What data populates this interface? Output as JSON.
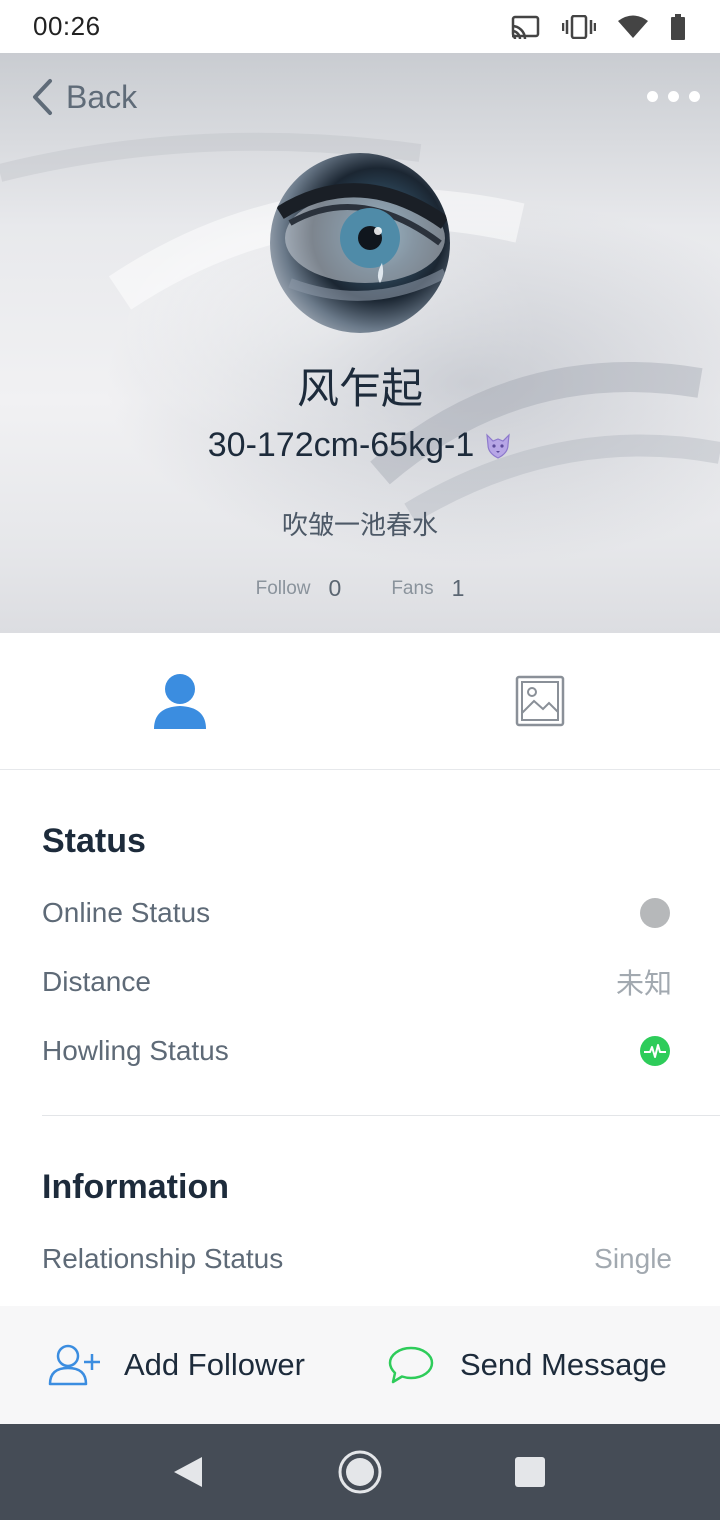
{
  "status_bar": {
    "time": "00:26",
    "icons": [
      "cast-icon",
      "vibrate-icon",
      "wifi-icon",
      "battery-icon"
    ]
  },
  "header": {
    "back_label": "Back",
    "more_icon": "more-dots-icon",
    "username": "风乍起",
    "stats": "30-172cm-65kg-1",
    "signature": "吹皱一池春水",
    "follow_label": "Follow",
    "follow_count": "0",
    "fans_label": "Fans",
    "fans_count": "1"
  },
  "tabs": [
    {
      "icon": "person-icon",
      "active": true,
      "color": "#3b8de0"
    },
    {
      "icon": "image-icon",
      "active": false,
      "color": "#8a9098"
    }
  ],
  "status_section": {
    "title": "Status",
    "rows": [
      {
        "label": "Online Status",
        "value_icon": "gray-dot-icon",
        "color": "#b6b8ba"
      },
      {
        "label": "Distance",
        "value": "未知"
      },
      {
        "label": "Howling Status",
        "value_icon": "pulse-icon",
        "color": "#2ecc5a"
      }
    ]
  },
  "information_section": {
    "title": "Information",
    "rows": [
      {
        "label": "Relationship Status",
        "value": "Single"
      }
    ]
  },
  "actions": {
    "add_follower": "Add Follower",
    "send_message": "Send Message",
    "add_icon_color": "#3b8de0",
    "message_icon_color": "#2ecc5a"
  },
  "nav_bar": {
    "buttons": [
      "back-triangle-icon",
      "home-circle-icon",
      "recents-square-icon"
    ]
  }
}
